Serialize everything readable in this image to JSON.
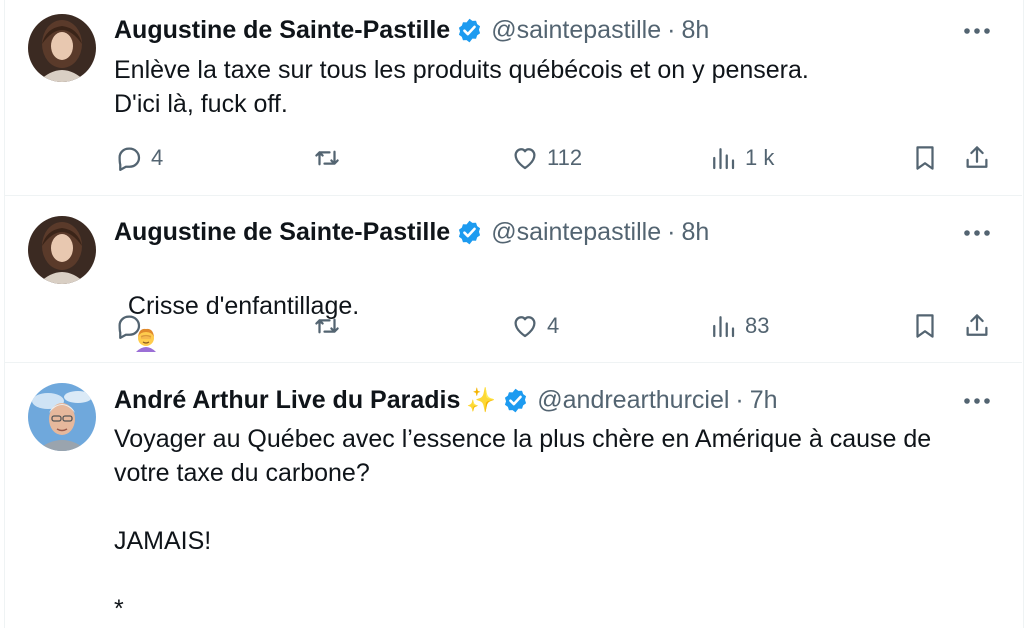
{
  "colors": {
    "text": "#0f1419",
    "muted": "#536471",
    "verified": "#1d9bf0",
    "divider": "#eff3f4"
  },
  "tweets": [
    {
      "name": "Augustine de Sainte-Pastille",
      "handle": "@saintepastille",
      "separator": "·",
      "time": "8h",
      "text": "Enlève la taxe sur tous les produits québécois et on y pensera.\nD'ici là, fuck off.",
      "replies": "4",
      "retweets": "",
      "likes": "112",
      "views": "1 k"
    },
    {
      "name": "Augustine de Sainte-Pastille",
      "handle": "@saintepastille",
      "separator": "·",
      "time": "8h",
      "text": "Crisse d'enfantillage.",
      "emoji": "woman-facepalming",
      "replies": "",
      "retweets": "",
      "likes": "4",
      "views": "83"
    },
    {
      "name": "André Arthur Live du Paradis",
      "name_emoji": "✨",
      "handle": "@andrearthurciel",
      "separator": "·",
      "time": "7h",
      "text": "Voyager au Québec avec l’essence la plus chère en Amérique à cause de\nvotre taxe du carbone?\n\nJAMAIS!\n\n*"
    }
  ]
}
